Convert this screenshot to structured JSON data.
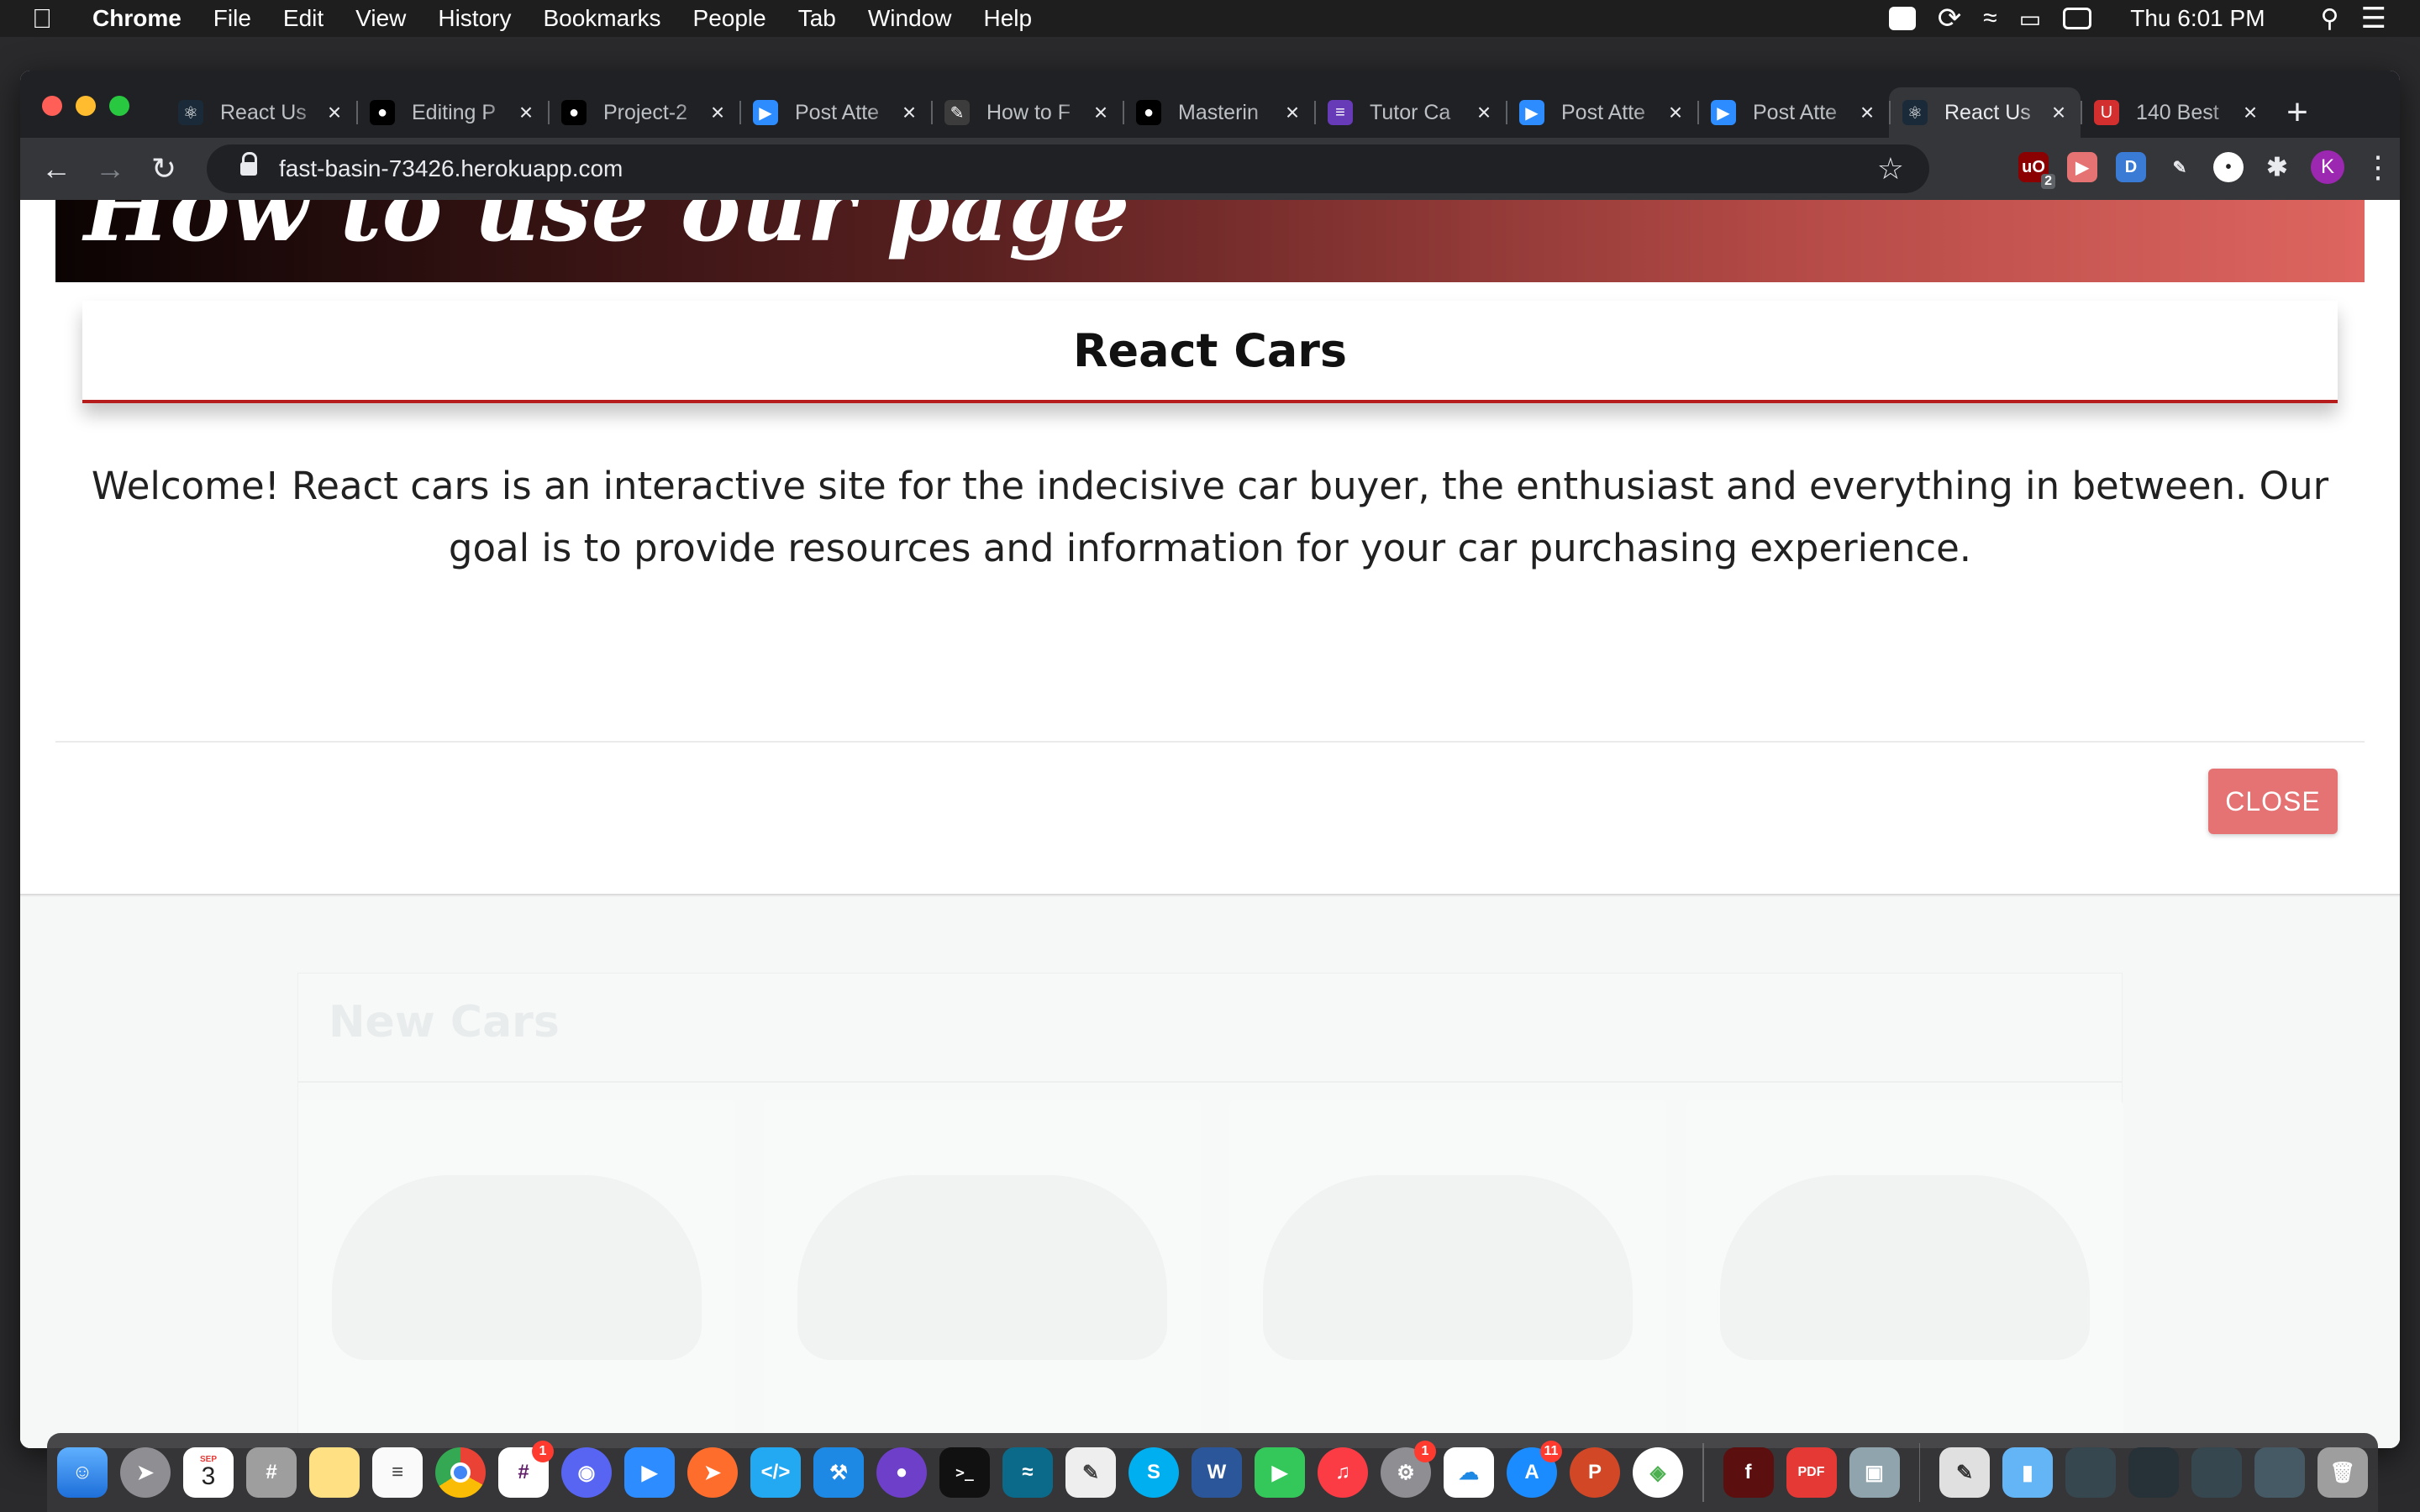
{
  "menubar": {
    "apple": "",
    "items": [
      "Chrome",
      "File",
      "Edit",
      "View",
      "History",
      "Bookmarks",
      "People",
      "Tab",
      "Window",
      "Help"
    ],
    "clock": "Thu 6:01 PM"
  },
  "browser": {
    "tabs": [
      {
        "title": "React Us",
        "favicon": "react-icon",
        "color": "#1b2a38",
        "active": false
      },
      {
        "title": "Editing P",
        "favicon": "github-icon",
        "color": "#000000",
        "active": false
      },
      {
        "title": "Project-2",
        "favicon": "github-icon",
        "color": "#000000",
        "active": false
      },
      {
        "title": "Post Atte",
        "favicon": "zoom-icon",
        "color": "#2d8cff",
        "active": false
      },
      {
        "title": "How to F",
        "favicon": "feather-icon",
        "color": "#3c3c3c",
        "active": false
      },
      {
        "title": "Masterin",
        "favicon": "github-icon",
        "color": "#000000",
        "active": false
      },
      {
        "title": "Tutor Ca",
        "favicon": "list-icon",
        "color": "#673ab7",
        "active": false
      },
      {
        "title": "Post Atte",
        "favicon": "zoom-icon",
        "color": "#2d8cff",
        "active": false
      },
      {
        "title": "Post Atte",
        "favicon": "zoom-icon",
        "color": "#2d8cff",
        "active": false
      },
      {
        "title": "React Us",
        "favicon": "react-icon",
        "color": "#1b2a38",
        "active": true
      },
      {
        "title": "140 Best",
        "favicon": "usn-icon",
        "color": "#d32f2f",
        "active": false
      }
    ],
    "url": "fast-basin-73426.herokuapp.com",
    "extension_badge": "2",
    "profile_initial": "K"
  },
  "page": {
    "banner_title": "How to use our page",
    "modal": {
      "title": "React Cars",
      "body": "Welcome! React cars is an interactive site for the indecisive car buyer, the enthusiast and everything in between. Our goal is to provide resources and information for your car purchasing experience.",
      "close_label": "CLOSE"
    },
    "section_title": "New Cars"
  },
  "dock": {
    "calendar_month": "SEP",
    "calendar_day": "3",
    "badges": {
      "slack": "1",
      "settings": "1",
      "appstore": "11"
    }
  }
}
